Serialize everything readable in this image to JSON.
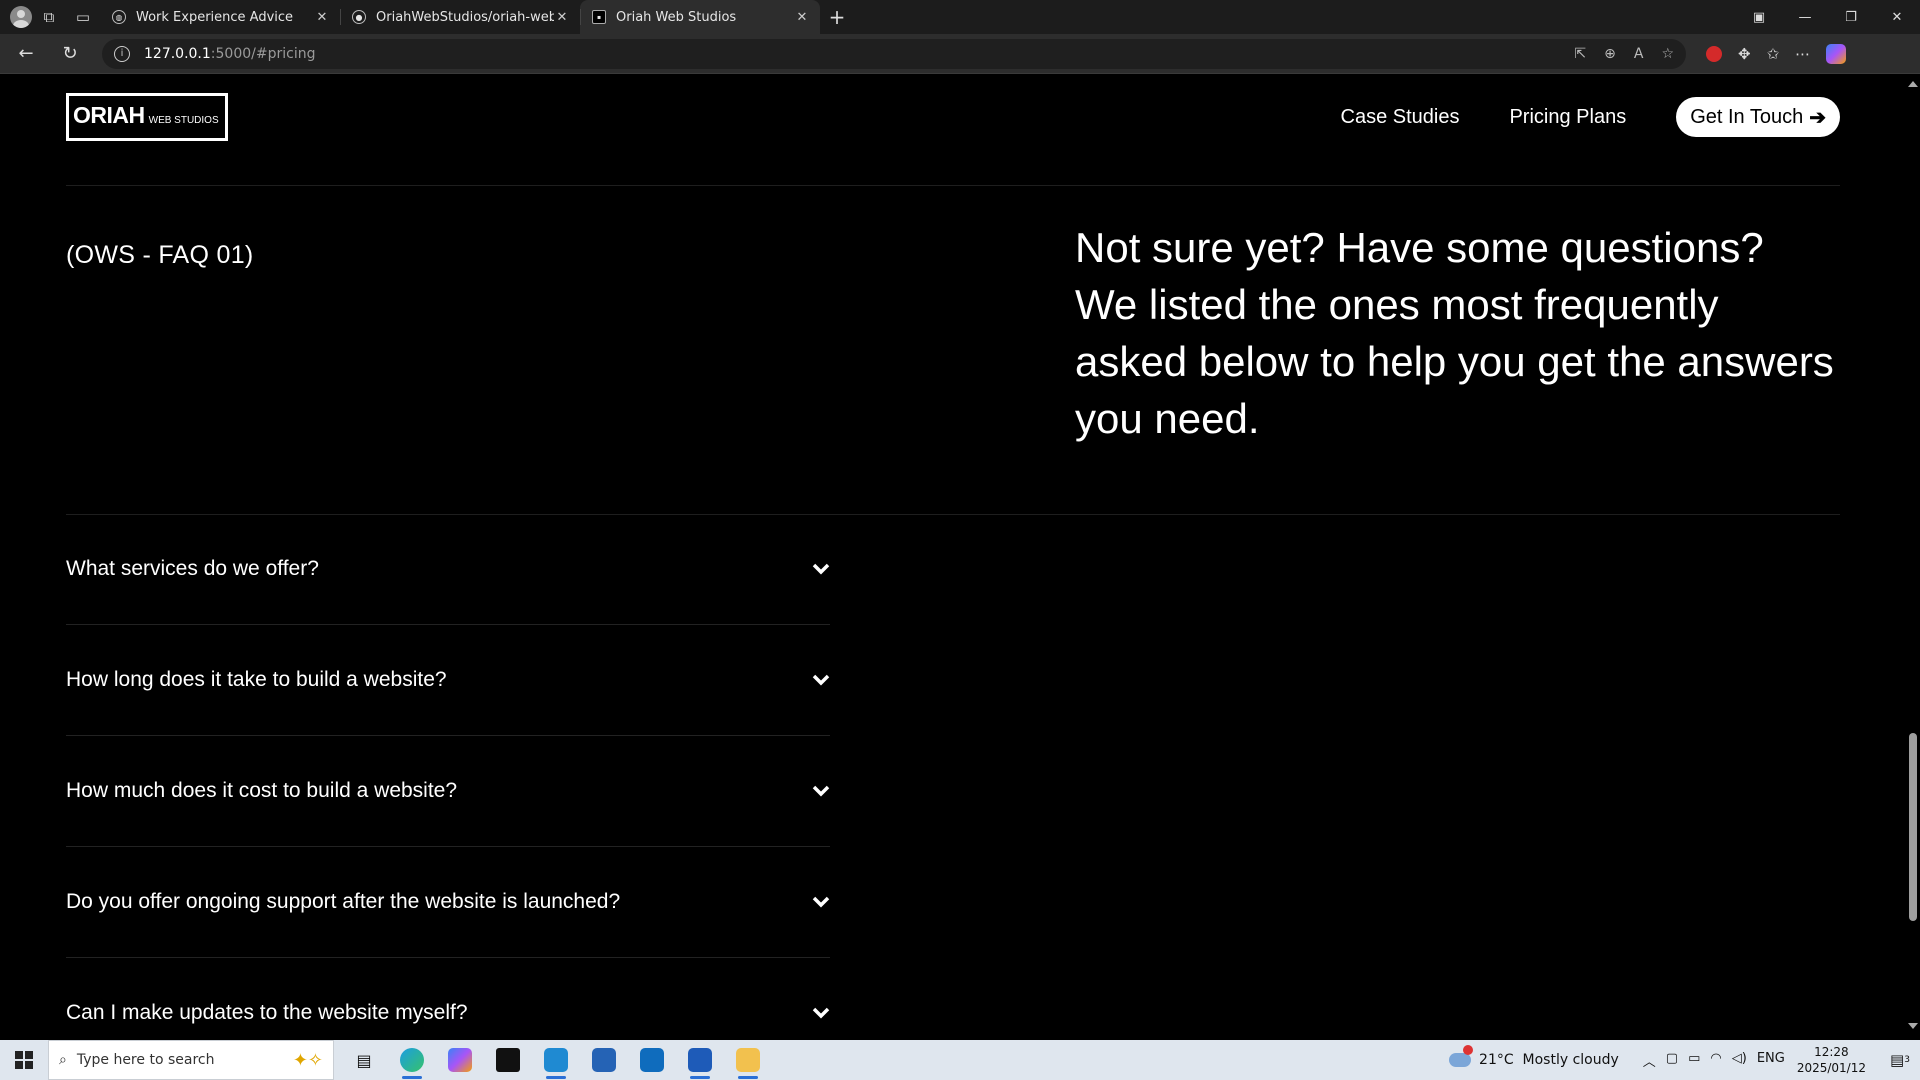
{
  "browser": {
    "tabs": [
      {
        "title": "Work Experience Advice",
        "active": false
      },
      {
        "title": "OriahWebStudios/oriah-web-studios",
        "active": false
      },
      {
        "title": "Oriah Web Studios",
        "active": true
      }
    ],
    "address": {
      "host": "127.0.0.1",
      "path": ":5000/#pricing"
    }
  },
  "site": {
    "logo": {
      "big": "ORIAH",
      "small": "WEB STUDIOS"
    },
    "nav": {
      "case_studies": "Case Studies",
      "pricing_plans": "Pricing Plans",
      "cta": "Get In Touch"
    }
  },
  "faq": {
    "tag": "(OWS - FAQ 01)",
    "intro": "Not sure yet? Have some questions? We listed the ones most frequently asked below to help you get the answers you need.",
    "items": [
      "What services do we offer?",
      "How long does it take to build a website?",
      "How much does it cost to build a website?",
      "Do you offer ongoing support after the website is launched?",
      "Can I make updates to the website myself?"
    ]
  },
  "taskbar": {
    "search_placeholder": "Type here to search",
    "weather": {
      "temp": "21°C",
      "desc": "Mostly cloudy"
    },
    "language": "ENG",
    "time": "12:28",
    "date": "2025/01/12",
    "notification_count": "3"
  },
  "colors": {
    "page_bg": "#000000",
    "text": "#ffffff",
    "taskbar_bg": "#dfe6ee",
    "accent": "#2a6fd6"
  }
}
